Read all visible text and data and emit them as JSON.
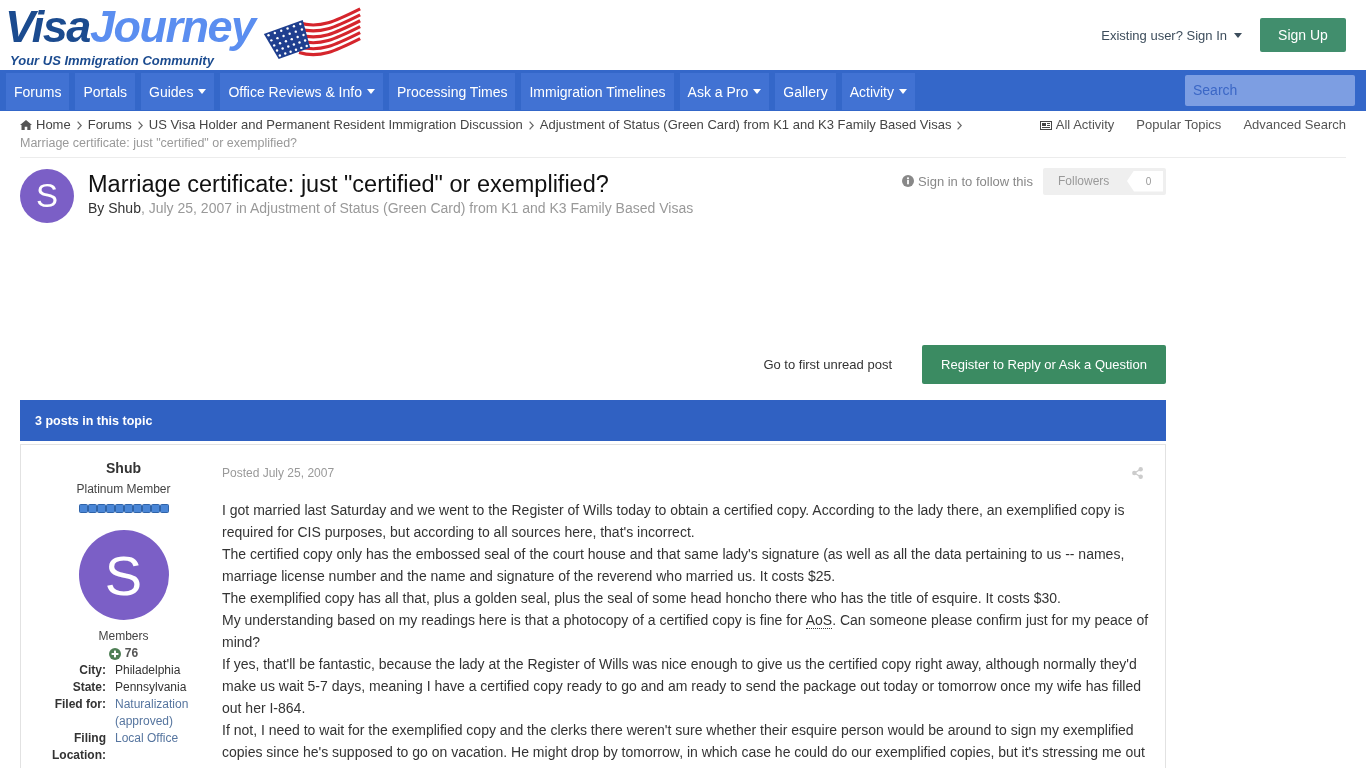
{
  "header": {
    "logo": {
      "name_part_1": "Visa",
      "name_part_2": "Journey",
      "tagline": "Your US Immigration Community"
    },
    "sign_in": {
      "label": "Existing user? Sign In"
    },
    "sign_up": {
      "label": "Sign Up"
    }
  },
  "nav": {
    "items": [
      {
        "label": "Forums",
        "has_menu": false
      },
      {
        "label": "Portals",
        "has_menu": false
      },
      {
        "label": "Guides",
        "has_menu": true
      },
      {
        "label": "Office Reviews & Info",
        "has_menu": true
      },
      {
        "label": "Processing Times",
        "has_menu": false
      },
      {
        "label": "Immigration Timelines",
        "has_menu": false
      },
      {
        "label": "Ask a Pro",
        "has_menu": true
      },
      {
        "label": "Gallery",
        "has_menu": false
      },
      {
        "label": "Activity",
        "has_menu": true
      }
    ],
    "search": {
      "placeholder": "Search"
    }
  },
  "breadcrumb": {
    "items": [
      {
        "label": "Home",
        "has_icon": true
      },
      {
        "label": "Forums",
        "has_icon": false
      },
      {
        "label": "US Visa Holder and Permanent Resident Immigration Discussion",
        "has_icon": false
      },
      {
        "label": "Adjustment of Status (Green Card) from K1 and K3 Family Based Visas",
        "has_icon": false
      }
    ],
    "current": "Marriage certificate: just \"certified\" or exemplified?"
  },
  "quick_links": [
    {
      "label": "All Activity",
      "has_icon": true
    },
    {
      "label": "Popular Topics",
      "has_icon": false
    },
    {
      "label": "Advanced Search",
      "has_icon": false
    }
  ],
  "topic": {
    "avatar_letter": "S",
    "title": "Marriage certificate: just \"certified\" or exemplified?",
    "byline": {
      "text_before": "By",
      "author": "Shub",
      "text_after": ", July 25, 2007 in",
      "forum": "Adjustment of Status (Green Card) from K1 and K3 Family Based Visas"
    },
    "follow": {
      "label": "Sign in to follow this",
      "button": "Followers",
      "count": "0"
    }
  },
  "actions": {
    "unread_link": "Go to first unread post",
    "reply_button": "Register to Reply or Ask a Question"
  },
  "posts_bar": {
    "label": "3 posts in this topic"
  },
  "post": {
    "author": {
      "name": "Shub",
      "rank": "Platinum Member",
      "avatar_letter": "S",
      "group": "Members",
      "reputation": "76",
      "fields": [
        {
          "label": "City:",
          "value": "Philadelphia",
          "kind": "text"
        },
        {
          "label": "State:",
          "value": "Pennsylvania",
          "kind": "text"
        },
        {
          "label": "Filed for:",
          "value": "Naturalization (approved)",
          "kind": "link"
        },
        {
          "label": "Filing Location:",
          "value": "Local Office",
          "kind": "link"
        }
      ]
    },
    "date": "Posted July 25, 2007",
    "paragraphs": [
      {
        "segments": [
          {
            "text": "I got married last Saturday and we went to the Register of Wills today to obtain a certified copy. According to the lady there, an exemplified copy is required for CIS purposes, but according to all sources here, that's incorrect.",
            "abbreviation": false
          }
        ]
      },
      {
        "segments": [
          {
            "text": "The certified copy only has the embossed seal of the court house and that same lady's signature (as well as all the data pertaining to us -- names, marriage license number and the name and signature of the reverend who married us. It costs $25.",
            "abbreviation": false
          }
        ]
      },
      {
        "segments": [
          {
            "text": "The exemplified copy has all that, plus a golden seal, plus the seal of some head honcho there who has the title of esquire. It costs $30.",
            "abbreviation": false
          }
        ]
      },
      {
        "segments": [
          {
            "text": "My understanding based on my readings here is that a photocopy of a certified copy is fine for ",
            "abbreviation": false
          },
          {
            "text": "AoS",
            "abbreviation": true
          },
          {
            "text": ". Can someone please confirm just for my peace of mind?",
            "abbreviation": false
          }
        ]
      },
      {
        "segments": [
          {
            "text": "If yes, that'll be fantastic, because the lady at the Register of Wills was nice enough to give us the certified copy right away, although normally they'd make us wait 5-7 days, meaning I have a certified copy ready to go and am ready to send the package out today or tomorrow once my wife has filled out her I-864.",
            "abbreviation": false
          }
        ]
      },
      {
        "segments": [
          {
            "text": "If not, I need to wait for the exemplified copy and the clerks there weren't sure whether their esquire person would be around to sign my exemplified copies since he's supposed to go on vacation. He might drop by tomorrow, in which case he could do our exemplified copies, but it's stressing me out",
            "abbreviation": false
          }
        ]
      }
    ]
  }
}
